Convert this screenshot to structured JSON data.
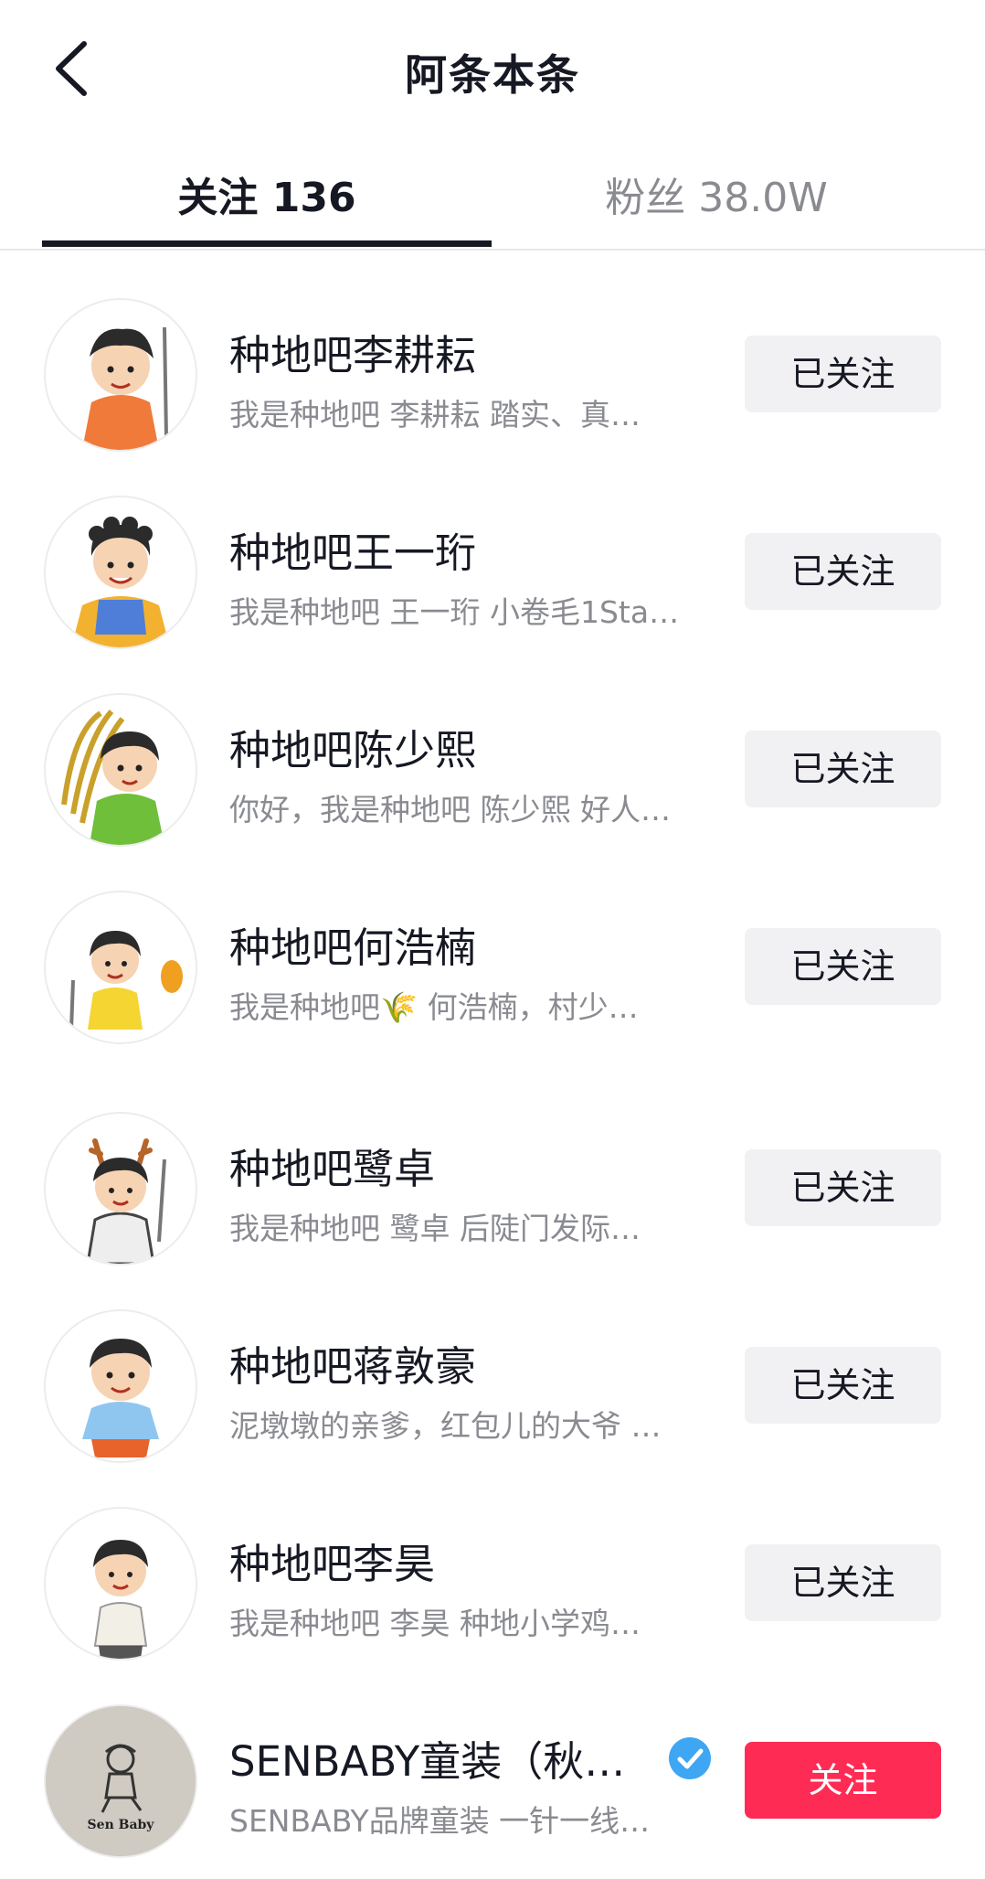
{
  "header": {
    "title": "阿条本条",
    "back_icon": "chevron-left-icon"
  },
  "tabs": [
    {
      "label": "关注 136",
      "active": true
    },
    {
      "label": "粉丝 38.0W",
      "active": false
    }
  ],
  "accent_color": "#fe2c55",
  "verified_color": "#3ea6f2",
  "follow_list": [
    {
      "name": "种地吧李耕耘",
      "desc": "我是种地吧 李耕耘  踏实、真…",
      "button": "已关注",
      "avatar": "cartoon-avatar"
    },
    {
      "name": "种地吧王一珩",
      "desc": "我是种地吧 王一珩 小卷毛1Sta…",
      "button": "已关注",
      "avatar": "cartoon-avatar"
    },
    {
      "name": "种地吧陈少熙",
      "desc": "你好，我是种地吧 陈少熙 好人…",
      "button": "已关注",
      "avatar": "cartoon-avatar"
    },
    {
      "name": "种地吧何浩楠",
      "desc": "我是种地吧🌾 何浩楠，村少…",
      "button": "已关注",
      "avatar": "cartoon-avatar"
    },
    {
      "name": "种地吧鹭卓",
      "desc": "我是种地吧 鹭卓  后陡门发际…",
      "button": "已关注",
      "avatar": "cartoon-avatar"
    },
    {
      "name": "种地吧蒋敦豪",
      "desc": "泥墩墩的亲爹，红包儿的大爷 …",
      "button": "已关注",
      "avatar": "cartoon-avatar"
    },
    {
      "name": "种地吧李昊",
      "desc": "我是种地吧 李昊  种地小学鸡…",
      "button": "已关注",
      "avatar": "cartoon-avatar"
    },
    {
      "name": "SENBABY童装（秋…",
      "desc": "SENBABY品牌童装  一针一线…",
      "button": "关注",
      "avatar": "brand-logo",
      "verified": true,
      "avatar_text": "Sen Baby"
    }
  ]
}
